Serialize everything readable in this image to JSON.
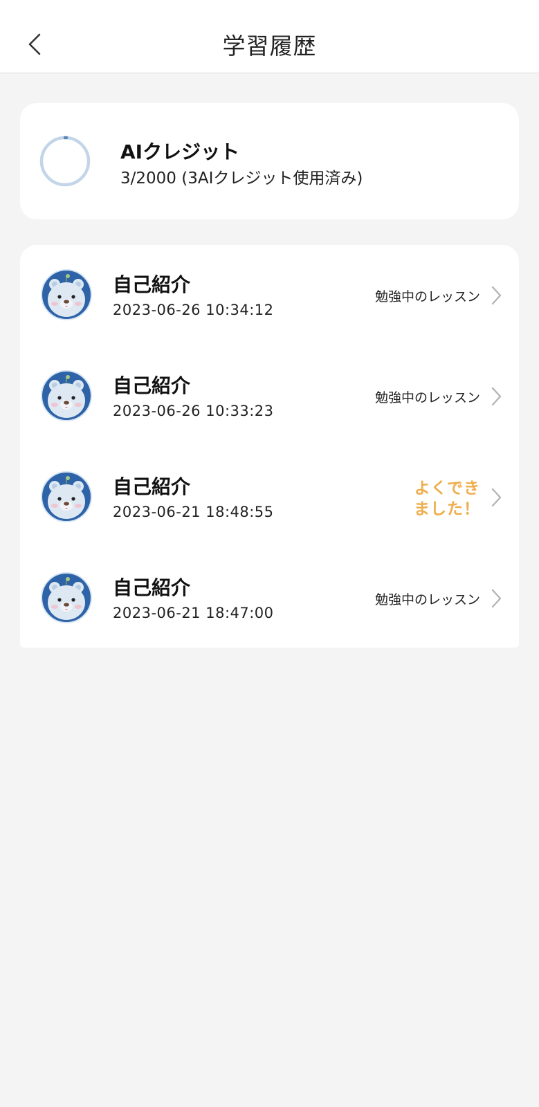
{
  "header": {
    "title": "学習履歴",
    "back_icon": "chevron-left-icon"
  },
  "credit": {
    "title": "AIクレジット",
    "detail": "3/2000 (3AIクレジット使用済み)",
    "used": 3,
    "total": 2000,
    "ring_color": "#c3d5e8",
    "ring_progress_color": "#5c84b4"
  },
  "history": {
    "items": [
      {
        "title": "自己紹介",
        "date": "2023-06-26 10:34:12",
        "status": "勉強中のレッスン",
        "status_type": "in-progress"
      },
      {
        "title": "自己紹介",
        "date": "2023-06-26 10:33:23",
        "status": "勉強中のレッスン",
        "status_type": "in-progress"
      },
      {
        "title": "自己紹介",
        "date": "2023-06-21 18:48:55",
        "status": "よくできました！",
        "status_type": "good",
        "status_line1": "よくでき",
        "status_line2": "ました！"
      },
      {
        "title": "自己紹介",
        "date": "2023-06-21 18:47:00",
        "status": "勉強中のレッスン",
        "status_type": "in-progress"
      }
    ]
  },
  "colors": {
    "background": "#f4f4f4",
    "card": "#ffffff",
    "good_status": "#efad4c",
    "avatar_bg": "#2e63a7"
  }
}
